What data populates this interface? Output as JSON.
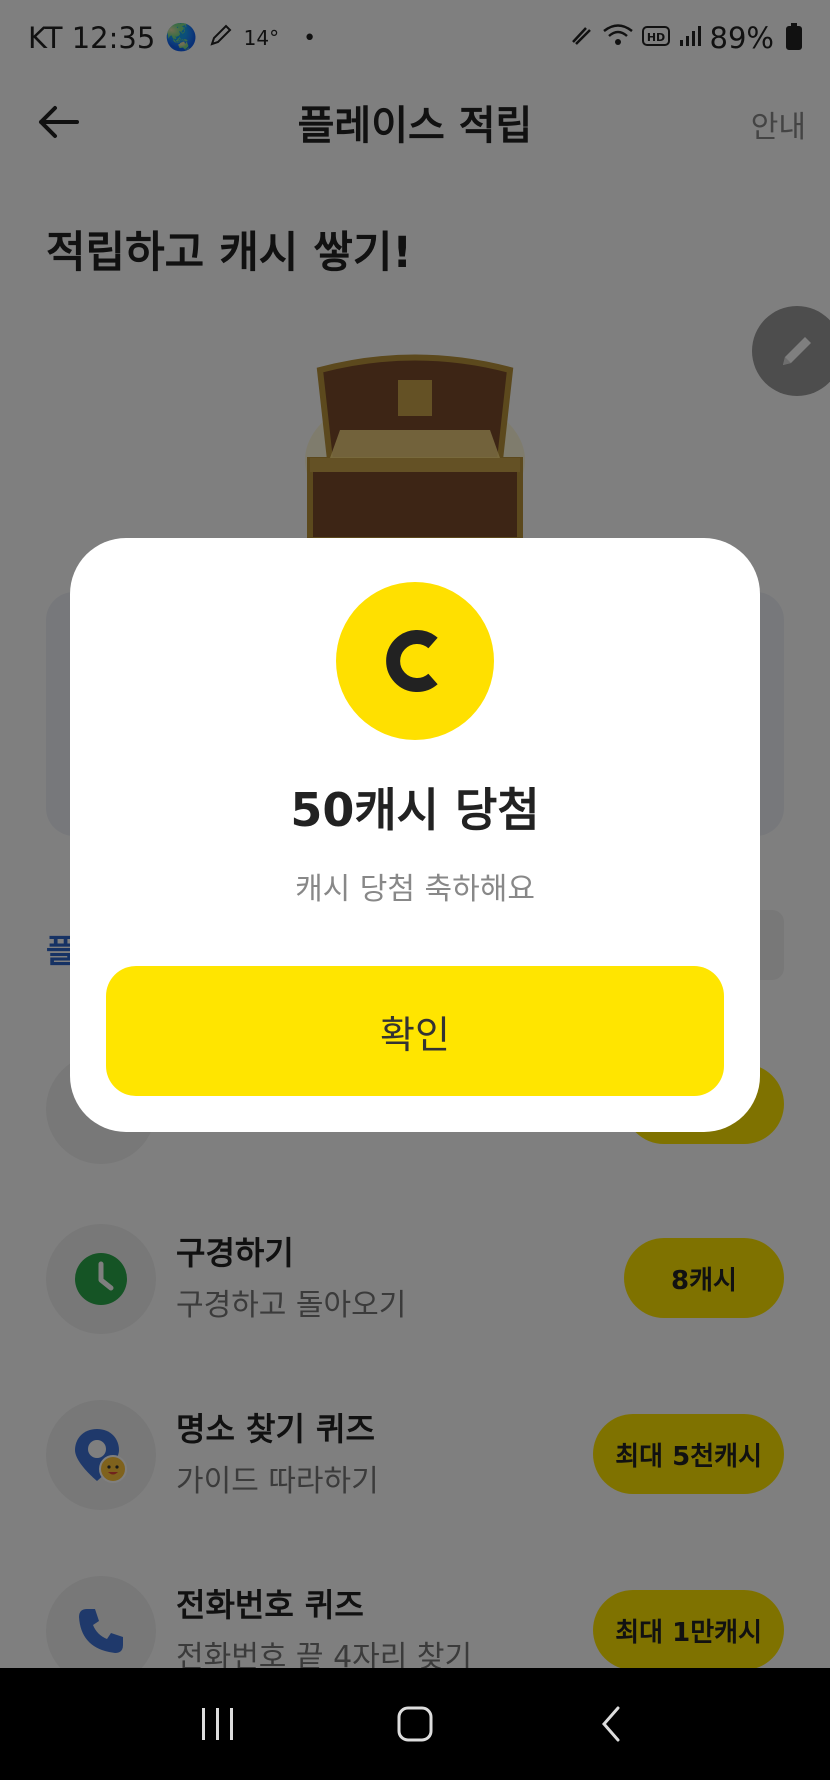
{
  "status_bar": {
    "carrier_time": "KT 12:35",
    "temperature": "14°",
    "battery": "89%",
    "icons": [
      "globe-icon",
      "pen-icon",
      "dot-icon",
      "mute-icon",
      "wifi-icon",
      "hd-icon",
      "signal-icon",
      "battery-icon"
    ]
  },
  "header": {
    "title": "플레이스 적립",
    "guide_label": "안내"
  },
  "section_title": "적립하고 캐시 쌓기!",
  "place_label": "플",
  "missions": [
    {
      "title": "구경하기",
      "desc": "구경하고 돌아오기",
      "reward": "8캐시",
      "icon": "clock-icon"
    },
    {
      "title": "명소 찾기 퀴즈",
      "desc": "가이드 따라하기",
      "reward": "최대 5천캐시",
      "icon": "location-pin-icon"
    },
    {
      "title": "전화번호 퀴즈",
      "desc": "전화번호 끝 4자리 찾기",
      "reward": "최대 1만캐시",
      "icon": "phone-icon"
    }
  ],
  "modal": {
    "coin_letter": "C",
    "title": "50캐시 당첨",
    "subtitle": "캐시 당첨 축하해요",
    "confirm_label": "확인"
  },
  "colors": {
    "accent_yellow": "#ffe500",
    "link_blue": "#2d64c8",
    "clock_green": "#2aa84a"
  }
}
